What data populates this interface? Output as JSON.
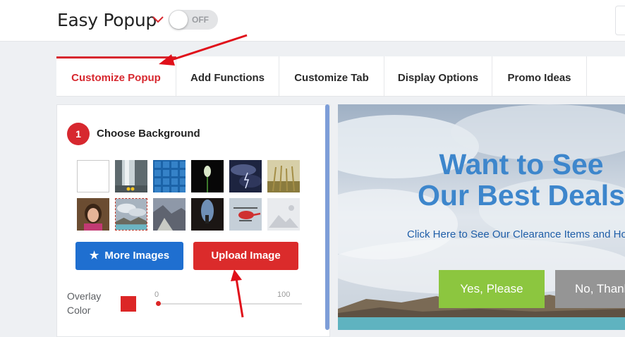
{
  "header": {
    "app_title": "Easy Popup",
    "toggle_label": "OFF"
  },
  "tabs": [
    {
      "label": "Customize Popup",
      "active": true
    },
    {
      "label": "Add Functions",
      "active": false
    },
    {
      "label": "Customize Tab",
      "active": false
    },
    {
      "label": "Display Options",
      "active": false
    },
    {
      "label": "Promo Ideas",
      "active": false
    }
  ],
  "editor": {
    "step_number": "1",
    "step_label": "Choose Background",
    "thumbnails": [
      {
        "name": "plain-white-background"
      },
      {
        "name": "waterfall-background"
      },
      {
        "name": "blue-tiles-background"
      },
      {
        "name": "flower-bud-background"
      },
      {
        "name": "storm-clouds-background"
      },
      {
        "name": "wheat-field-background"
      },
      {
        "name": "girl-portrait-background"
      },
      {
        "name": "cloudy-lake-background",
        "selected": true
      },
      {
        "name": "rocky-coast-background"
      },
      {
        "name": "cave-background"
      },
      {
        "name": "helicopter-background"
      },
      {
        "name": "image-placeholder"
      }
    ],
    "more_images_label": "More Images",
    "upload_image_label": "Upload Image",
    "overlay_color_label": "Overlay Color",
    "overlay_color": "#dc2626",
    "slider_min": "0",
    "slider_max": "100",
    "slider_value": 0
  },
  "preview": {
    "headline_line1": "Want to See",
    "headline_line2": "Our Best Deals",
    "subtext": "Click Here to See Our Clearance Items and Hot Deals",
    "yes_label": "Yes, Please",
    "no_label": "No, Thanks"
  },
  "colors": {
    "accent_red": "#d7282f",
    "primary_blue": "#1f6fd0",
    "yes_green": "#8cc63f",
    "no_gray": "#959595",
    "headline_blue": "#3d86cc"
  }
}
